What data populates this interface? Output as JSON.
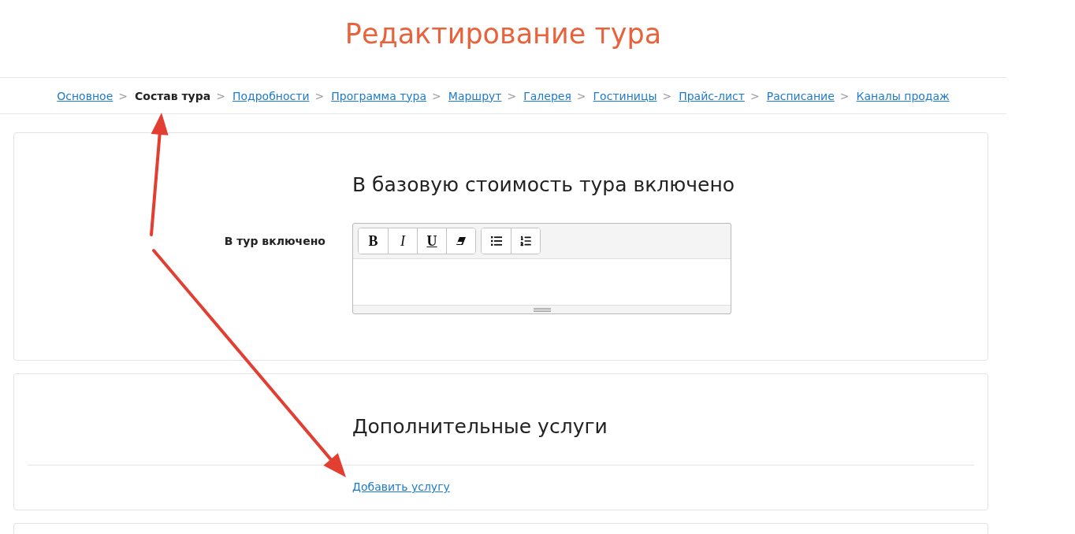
{
  "page": {
    "title": "Редактирование тура"
  },
  "breadcrumbs": [
    {
      "label": "Основное",
      "selected": false,
      "separator": ">"
    },
    {
      "label": "Состав тура",
      "selected": true,
      "separator": ">"
    },
    {
      "label": "Подробности",
      "selected": false,
      "separator": ">"
    },
    {
      "label": "Программа тура",
      "selected": false,
      "separator": ">"
    },
    {
      "label": "Маршрут",
      "selected": false,
      "separator": ">"
    },
    {
      "label": "Галерея",
      "selected": false,
      "separator": ">"
    },
    {
      "label": "Гостиницы",
      "selected": false,
      "separator": ">"
    },
    {
      "label": "Прайс-лист",
      "selected": false,
      "separator": ">"
    },
    {
      "label": "Расписание",
      "selected": false,
      "separator": ">"
    },
    {
      "label": "Каналы продаж",
      "selected": false
    }
  ],
  "included_section": {
    "heading": "В базовую стоимость тура включено",
    "field_label": "В тур включено",
    "editor": {
      "toolbar_groups": [
        {
          "buttons": [
            {
              "kind": "bold",
              "label": "B"
            },
            {
              "kind": "italic",
              "label": "I"
            },
            {
              "kind": "underline",
              "label": "U"
            },
            {
              "kind": "eraser"
            }
          ]
        },
        {
          "buttons": [
            {
              "kind": "bullet-list"
            },
            {
              "kind": "numbered-list"
            }
          ]
        }
      ]
    }
  },
  "services_section": {
    "heading": "Дополнительные услуги",
    "add_link": "Добавить услугу"
  },
  "annotations": [
    {
      "kind": "arrow"
    },
    {
      "kind": "arrow"
    }
  ]
}
